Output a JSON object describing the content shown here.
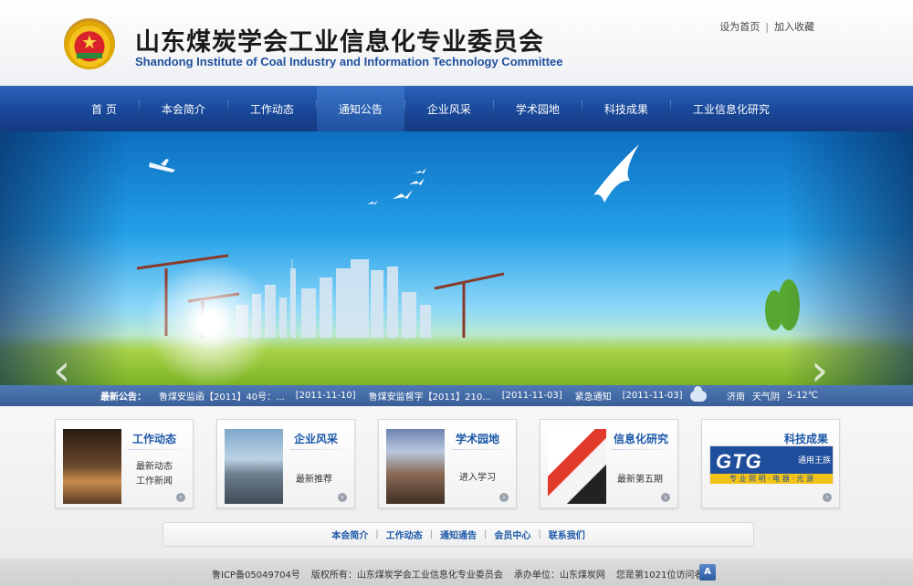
{
  "header": {
    "title_cn": "山东煤炭学会工业信息化专业委员会",
    "title_en": "Shandong Institute of Coal Industry and Information Technology Committee",
    "links": [
      "设为首页",
      "加入收藏"
    ]
  },
  "nav": {
    "items": [
      "首 页",
      "本会简介",
      "工作动态",
      "通知公告",
      "企业风采",
      "学术园地",
      "科技成果",
      "工业信息化研究"
    ],
    "active_index": 3
  },
  "banner": {
    "prev_label": "‹",
    "next_label": "›"
  },
  "notice": {
    "label": "最新公告：",
    "items": [
      {
        "title": "鲁煤安监函【2011】40号：...",
        "date": "[2011-11-10]"
      },
      {
        "title": "鲁煤安监督字【2011】210...",
        "date": "[2011-11-03]"
      },
      {
        "title": "紧急通知",
        "date": "[2011-11-03]"
      }
    ],
    "weather": {
      "city": "济南",
      "desc": "天气阴",
      "temp": "5-12℃"
    }
  },
  "cards": [
    {
      "title": "工作动态",
      "subs": [
        "最新动态",
        "工作新闻"
      ]
    },
    {
      "title": "企业风采",
      "subs": [
        "最新推荐"
      ]
    },
    {
      "title": "学术园地",
      "subs": [
        "进入学习"
      ]
    },
    {
      "title": "信息化研究",
      "subs": [
        "最新第五期"
      ]
    },
    {
      "title": "科技成果",
      "subs": [],
      "logo_text": "GTG",
      "logo_cn": "通用王族",
      "logo_strip": "专 业 照 明 · 电 器 · 光 源"
    }
  ],
  "bottom_links": [
    "本会简介",
    "工作动态",
    "通知通告",
    "会员中心",
    "联系我们"
  ],
  "footer": {
    "icp": "鲁ICP备05049704号",
    "copyright": "版权所有：山东煤炭学会工业信息化专业委员会",
    "host": "承办单位：山东煤炭网",
    "visitors": "您是第1021位访问者",
    "top_label": "A"
  },
  "colors": {
    "nav_bg": "#1a4a9c",
    "accent": "#1c58a8",
    "notice_bg": "#3a5f98"
  }
}
